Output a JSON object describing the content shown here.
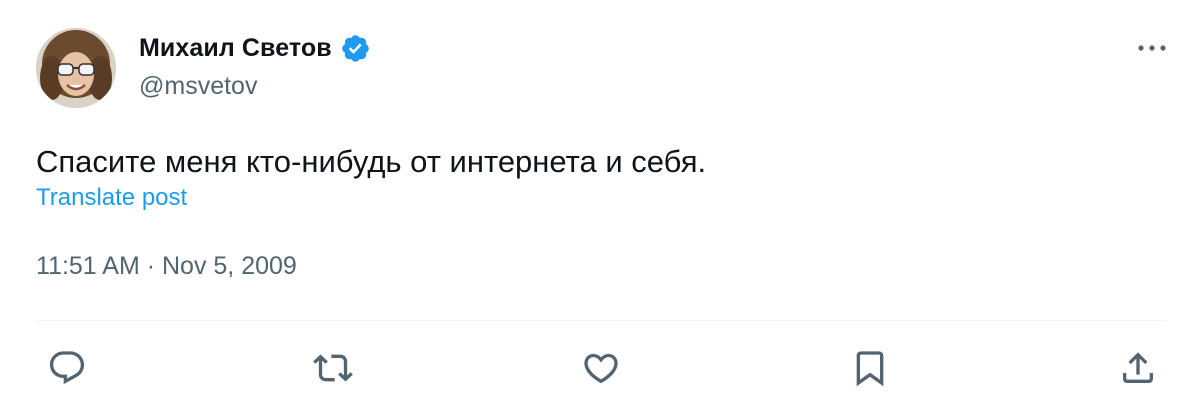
{
  "author": {
    "name": "Михаил Светов",
    "handle": "@msvetov",
    "verified": true,
    "avatar_icon": "avatar-photo-icon"
  },
  "tweet": {
    "text": "Спасите меня кто-нибудь от интернета и себя.",
    "translate_label": "Translate post",
    "timestamp": "11:51 AM · Nov 5, 2009"
  },
  "actions": [
    {
      "name": "reply",
      "icon": "reply-icon"
    },
    {
      "name": "repost",
      "icon": "repost-icon"
    },
    {
      "name": "like",
      "icon": "heart-icon"
    },
    {
      "name": "bookmark",
      "icon": "bookmark-icon"
    },
    {
      "name": "share",
      "icon": "share-icon"
    }
  ],
  "colors": {
    "accent": "#1d9bf0",
    "text": "#0f1419",
    "muted": "#536471",
    "divider": "#eff3f4"
  }
}
